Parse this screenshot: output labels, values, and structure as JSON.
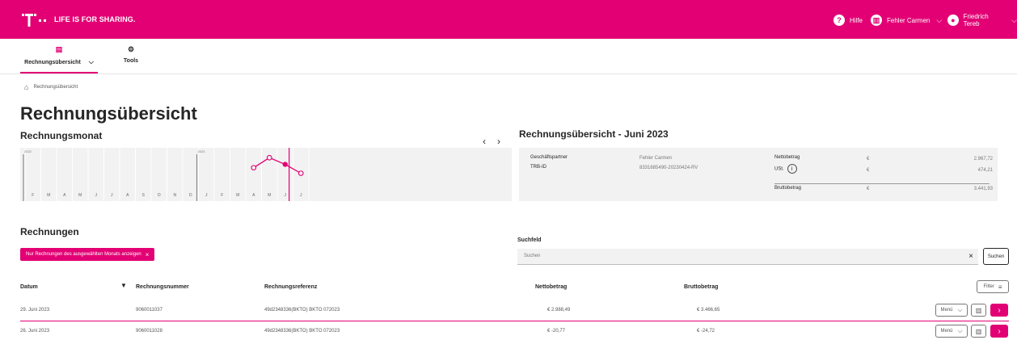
{
  "header": {
    "slogan": "LIFE IS FOR SHARING.",
    "help_label": "Hilfe",
    "account_label": "Fehler Carmen",
    "user_label": "Friedrich Tereb"
  },
  "tabs": [
    {
      "label": "Rechnungsübersicht"
    },
    {
      "label": "Tools"
    }
  ],
  "breadcrumb": {
    "current": "Rechnungsübersicht"
  },
  "page_title": "Rechnungsübersicht",
  "month_section": {
    "title": "Rechnungsmonat",
    "prev_icon": "‹",
    "next_icon": "›"
  },
  "chart_data": {
    "type": "line",
    "categories": [
      "F",
      "M",
      "A",
      "M",
      "J",
      "J",
      "A",
      "S",
      "O",
      "N",
      "D",
      "J",
      "F",
      "M",
      "A",
      "M",
      "J",
      "J"
    ],
    "year_labels": [
      {
        "index": 0,
        "label": "2022"
      },
      {
        "index": 11,
        "label": "2023"
      }
    ],
    "values": [
      null,
      null,
      null,
      null,
      null,
      null,
      null,
      null,
      null,
      null,
      null,
      null,
      null,
      null,
      3.0,
      3.9,
      3.3,
      2.5
    ],
    "selected_index": 16,
    "ylim": [
      0,
      4.5
    ],
    "accent_color": "#e20074"
  },
  "summary": {
    "title": "Rechnungsübersicht - Juni 2023",
    "partner_label": "Geschäftspartner",
    "partner_value": "Fehler Carmen",
    "trb_label": "TRB-ID",
    "trb_value": "8331685490-20230424-RV",
    "netto_label": "Nettobetrag",
    "ust_label": "USt.",
    "brutto_label": "Bruttobetrag",
    "currency": "€",
    "netto_value": "2.967,72",
    "ust_value": "474,21",
    "brutto_value": "3.441,93"
  },
  "invoices": {
    "title": "Rechnungen",
    "filter_chip": "Nur Rechnungen des ausgewählten Monats anzeigen",
    "search_label": "Suchfeld",
    "search_placeholder": "Suchen",
    "search_button": "Suchen",
    "filter_button": "Filter",
    "columns": [
      "Datum",
      "Rechnungsnummer",
      "Rechnungsreferenz",
      "Nettobetrag",
      "Bruttobetrag"
    ],
    "rows": [
      {
        "date": "29. Juni 2023",
        "number": "9060011037",
        "reference": "49d2348336(BKTO) BKTO 072023",
        "netto": "€ 2.988,49",
        "brutto": "€ 3.466,65",
        "menu": "Menü"
      },
      {
        "date": "26. Juni 2023",
        "number": "9060011028",
        "reference": "49d2348336(BKTO) BKTO 072023",
        "netto": "€ -20,77",
        "brutto": "€ -24,72",
        "menu": "Menü"
      }
    ]
  }
}
